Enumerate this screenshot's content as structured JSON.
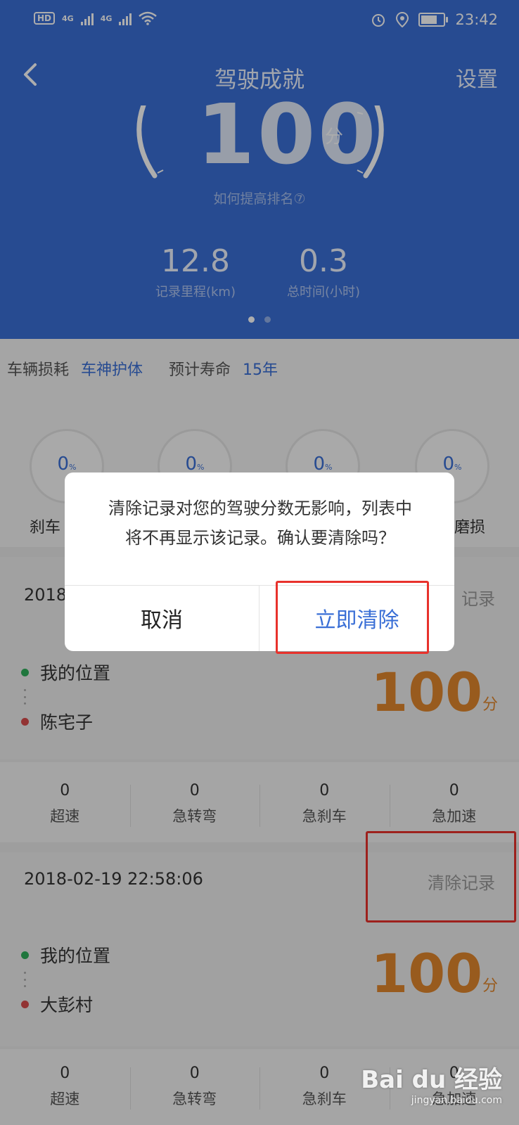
{
  "status_bar": {
    "network_left": "HD",
    "net1": "4G",
    "net2": "4G",
    "time": "23:42"
  },
  "header": {
    "title": "驾驶成就",
    "settings_label": "设置"
  },
  "score": {
    "value": "100",
    "unit": "分",
    "rank_hint": "如何提高排名⑦"
  },
  "stats": [
    {
      "value": "12.8",
      "label": "记录里程(km)"
    },
    {
      "value": "0.3",
      "label": "总时间(小时)"
    }
  ],
  "wear": {
    "label": "车辆损耗",
    "value": "车神护体",
    "life_label": "预计寿命",
    "life_value": "15年"
  },
  "gauges": [
    {
      "value": "0",
      "unit": "%",
      "label": "刹车"
    },
    {
      "value": "0",
      "unit": "%",
      "label": ""
    },
    {
      "value": "0",
      "unit": "%",
      "label": ""
    },
    {
      "value": "0",
      "unit": "%",
      "label": "磨损"
    }
  ],
  "trips": [
    {
      "date": "2018",
      "clear_label": "记录",
      "from": "我的位置",
      "to": "陈宅子",
      "score": "100",
      "score_unit": "分",
      "metrics": [
        {
          "value": "0",
          "label": "超速"
        },
        {
          "value": "0",
          "label": "急转弯"
        },
        {
          "value": "0",
          "label": "急刹车"
        },
        {
          "value": "0",
          "label": "急加速"
        }
      ]
    },
    {
      "date": "2018-02-19 22:58:06",
      "clear_label": "清除记录",
      "from": "我的位置",
      "to": "大彭村",
      "score": "100",
      "score_unit": "分",
      "metrics": [
        {
          "value": "0",
          "label": "超速"
        },
        {
          "value": "0",
          "label": "急转弯"
        },
        {
          "value": "0",
          "label": "急刹车"
        },
        {
          "value": "0",
          "label": "急加速"
        }
      ]
    }
  ],
  "dialog": {
    "line1": "清除记录对您的驾驶分数无影响，列表中",
    "line2": "将不再显示该记录。确认要清除吗？",
    "cancel_label": "取消",
    "confirm_label": "立即清除"
  },
  "watermark": {
    "text": "Bai du 经验",
    "sub": "jingyan.baidu.com"
  },
  "colors": {
    "header_blue": "#3a6fd6",
    "score_orange": "#e0862d",
    "highlight_red": "#e8322c"
  }
}
